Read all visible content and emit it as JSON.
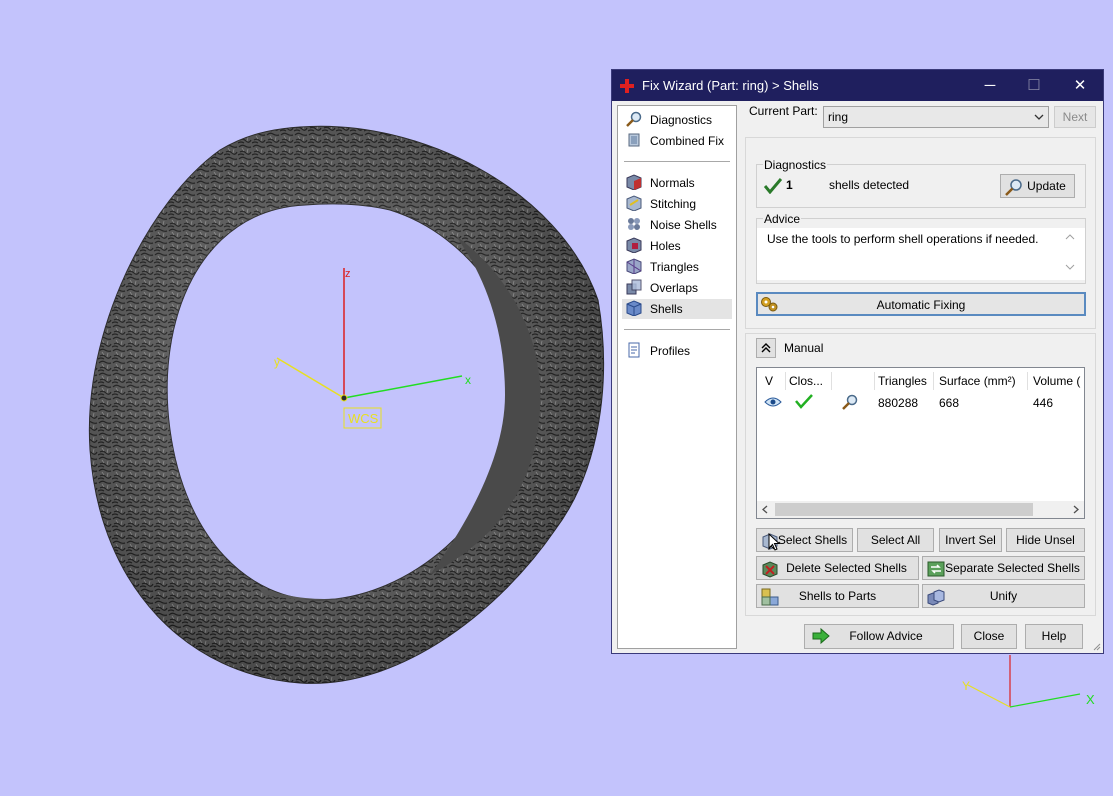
{
  "dialog": {
    "title": "Fix Wizard (Part: ring) > Shells",
    "minimize": "─",
    "maximize": "☐",
    "close": "✕"
  },
  "viewport": {
    "axis_z": "z",
    "axis_y": "y",
    "axis_x": "x",
    "wcs_label": "WCS",
    "mini_axis_x": "X",
    "mini_axis_y": "Y"
  },
  "nav": {
    "diagnostics": "Diagnostics",
    "combined_fix": "Combined Fix",
    "normals": "Normals",
    "stitching": "Stitching",
    "noise_shells": "Noise Shells",
    "holes": "Holes",
    "triangles": "Triangles",
    "overlaps": "Overlaps",
    "shells": "Shells",
    "profiles": "Profiles"
  },
  "part": {
    "label": "Current Part:",
    "value": "ring",
    "next": "Next"
  },
  "diagnostics": {
    "title": "Diagnostics",
    "count": "1",
    "text": "shells detected",
    "update": "Update"
  },
  "advice": {
    "title": "Advice",
    "text": "Use the tools to perform shell operations if needed.",
    "automatic_fixing": "Automatic Fixing"
  },
  "manual": {
    "title": "Manual",
    "columns": [
      "V",
      "Clos...",
      "",
      "Triangles",
      "Surface (mm²)",
      "Volume ("
    ],
    "rows": [
      {
        "triangles": "880288",
        "surface": "668",
        "volume": "446"
      }
    ]
  },
  "buttons": {
    "select_shells": "Select Shells",
    "select_all": "Select All",
    "invert_sel": "Invert Sel",
    "hide_unsel": "Hide Unsel",
    "delete_selected_shells": "Delete Selected Shells",
    "separate_selected_shells": "Separate Selected Shells",
    "shells_to_parts": "Shells to Parts",
    "unify": "Unify",
    "follow_advice": "Follow Advice",
    "close": "Close",
    "help": "Help"
  },
  "colors": {
    "background": "#c3c3fc",
    "titlebar": "#1f1f5e",
    "axis_x": "#22dd22",
    "axis_y": "#e8e020",
    "axis_z": "#dd2020"
  }
}
